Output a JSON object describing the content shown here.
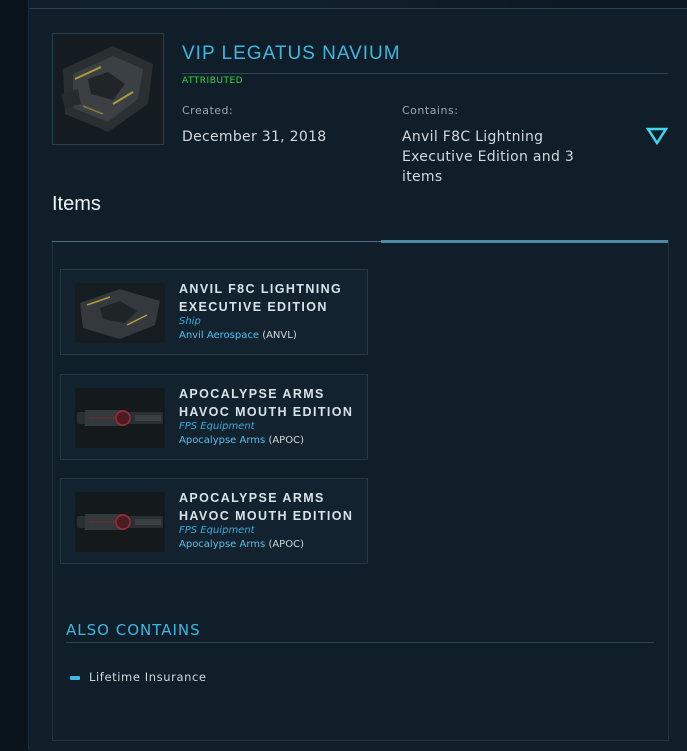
{
  "pledge": {
    "title": "VIP LEGATUS NAVIUM",
    "status": "ATTRIBUTED",
    "created_label": "Created:",
    "created_value": "December 31, 2018",
    "contains_label": "Contains:",
    "contains_value": "Anvil F8C Lightning Executive Edition and 3 items",
    "toggle_icon": "chevron-down-icon"
  },
  "items_section": {
    "heading": "Items",
    "items": [
      {
        "name": "ANVIL F8C LIGHTNING EXECUTIVE EDITION",
        "kind": "Ship",
        "maker": "Anvil Aerospace",
        "maker_code": "(ANVL)"
      },
      {
        "name": "APOCALYPSE ARMS HAVOC MOUTH EDITION",
        "kind": "FPS Equipment",
        "maker": "Apocalypse Arms",
        "maker_code": "(APOC)"
      },
      {
        "name": "APOCALYPSE ARMS HAVOC MOUTH EDITION",
        "kind": "FPS Equipment",
        "maker": "Apocalypse Arms",
        "maker_code": "(APOC)"
      }
    ]
  },
  "also_contains": {
    "heading": "ALSO CONTAINS",
    "items": [
      "Lifetime Insurance"
    ]
  },
  "colors": {
    "accent": "#3fb7e0",
    "status": "#3ad14a",
    "background": "#0f1e29"
  }
}
